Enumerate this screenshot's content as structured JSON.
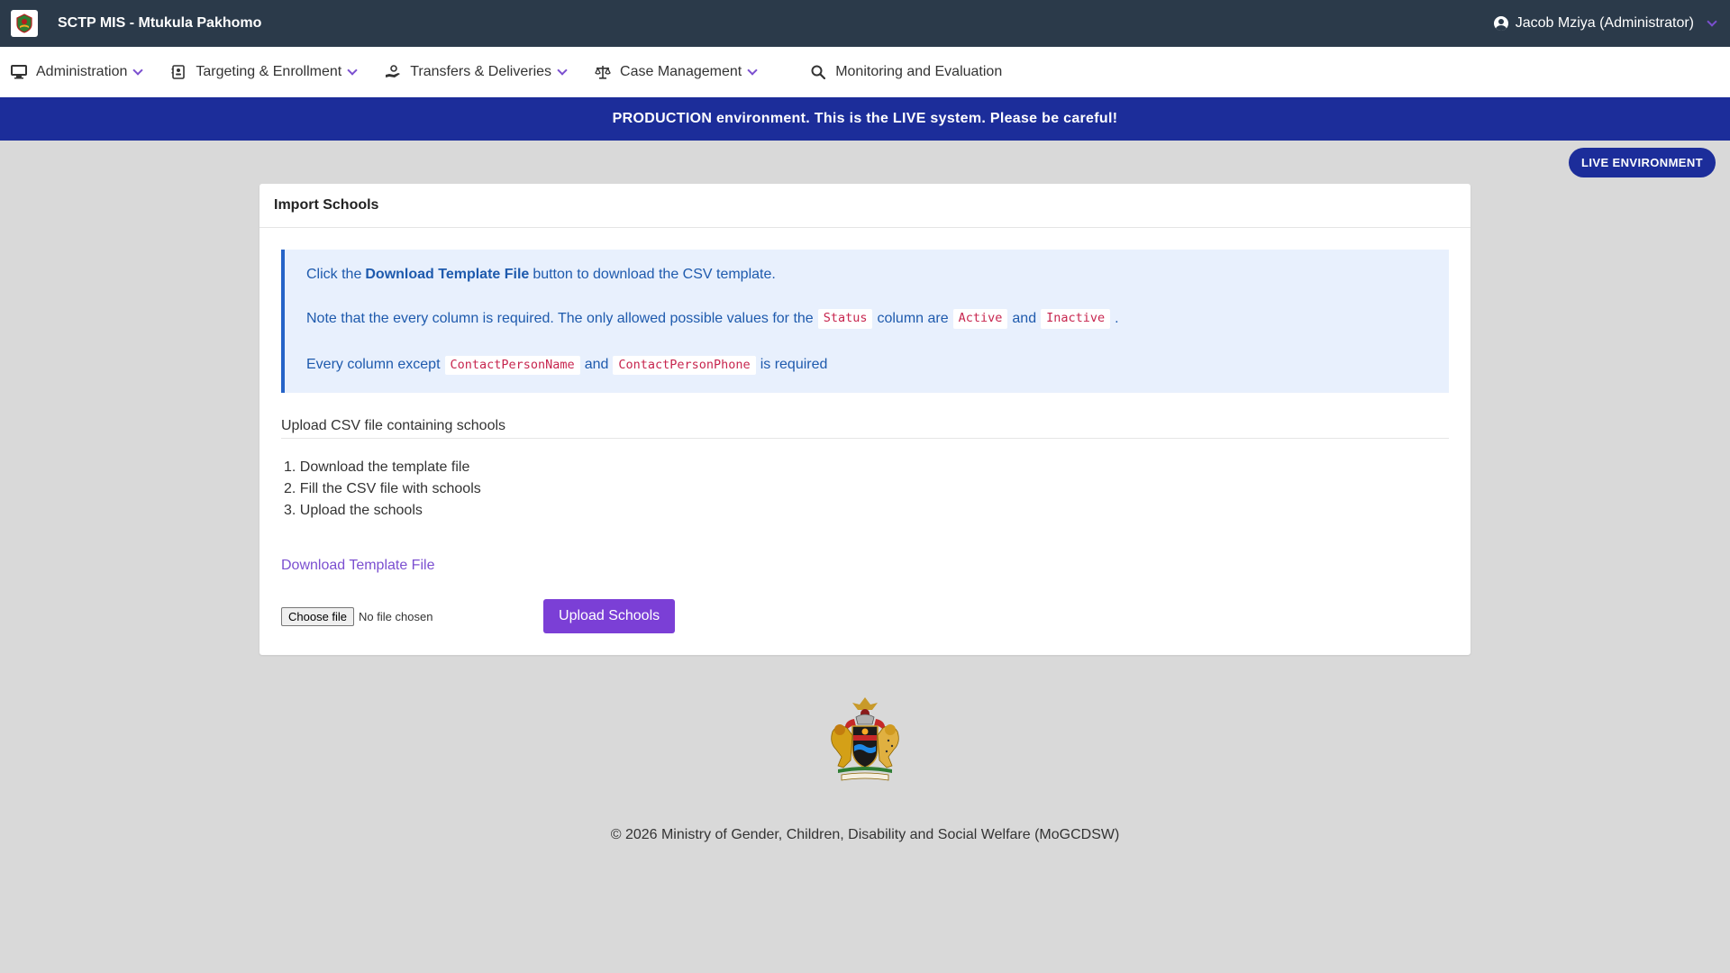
{
  "header": {
    "app_title": "SCTP MIS - Mtukula Pakhomo",
    "user": "Jacob Mziya (Administrator)"
  },
  "nav": [
    {
      "label": "Administration",
      "icon": "monitor-icon"
    },
    {
      "label": "Targeting & Enrollment",
      "icon": "id-card-icon"
    },
    {
      "label": "Transfers & Deliveries",
      "icon": "hand-money-icon"
    },
    {
      "label": "Case Management",
      "icon": "scales-icon"
    },
    {
      "label": "Monitoring and Evaluation",
      "icon": "search-icon"
    }
  ],
  "banner": "PRODUCTION environment. This is the LIVE system. Please be careful!",
  "live_badge": "LIVE ENVIRONMENT",
  "card": {
    "title": "Import Schools",
    "info": {
      "line1_pre": "Click the",
      "line1_bold": "Download Template File",
      "line1_post": "button to download the CSV template.",
      "line2_pre": "Note that the every column is required. The only allowed possible values for the",
      "line2_code1": "Status",
      "line2_mid": "column are",
      "line2_code2": "Active",
      "line2_and": "and",
      "line2_code3": "Inactive",
      "line2_end": ".",
      "line3_pre": "Every column except",
      "line3_code1": "ContactPersonName",
      "line3_and": "and",
      "line3_code2": "ContactPersonPhone",
      "line3_post": "is required"
    },
    "section_title": "Upload CSV file containing schools",
    "steps": [
      "1. Download the template file",
      "2. Fill the CSV file with schools",
      "3. Upload the schools"
    ],
    "download_link": "Download Template File",
    "choose_file": "Choose file",
    "no_file": "No file chosen",
    "upload_button": "Upload Schools"
  },
  "footer": "© 2026 Ministry of Gender, Children, Disability and Social Welfare (MoGCDSW)",
  "colors": {
    "topbar": "#2b3a4a",
    "banner": "#1c2d9a",
    "accent": "#7b3fd6",
    "info_text": "#1e5aad"
  }
}
